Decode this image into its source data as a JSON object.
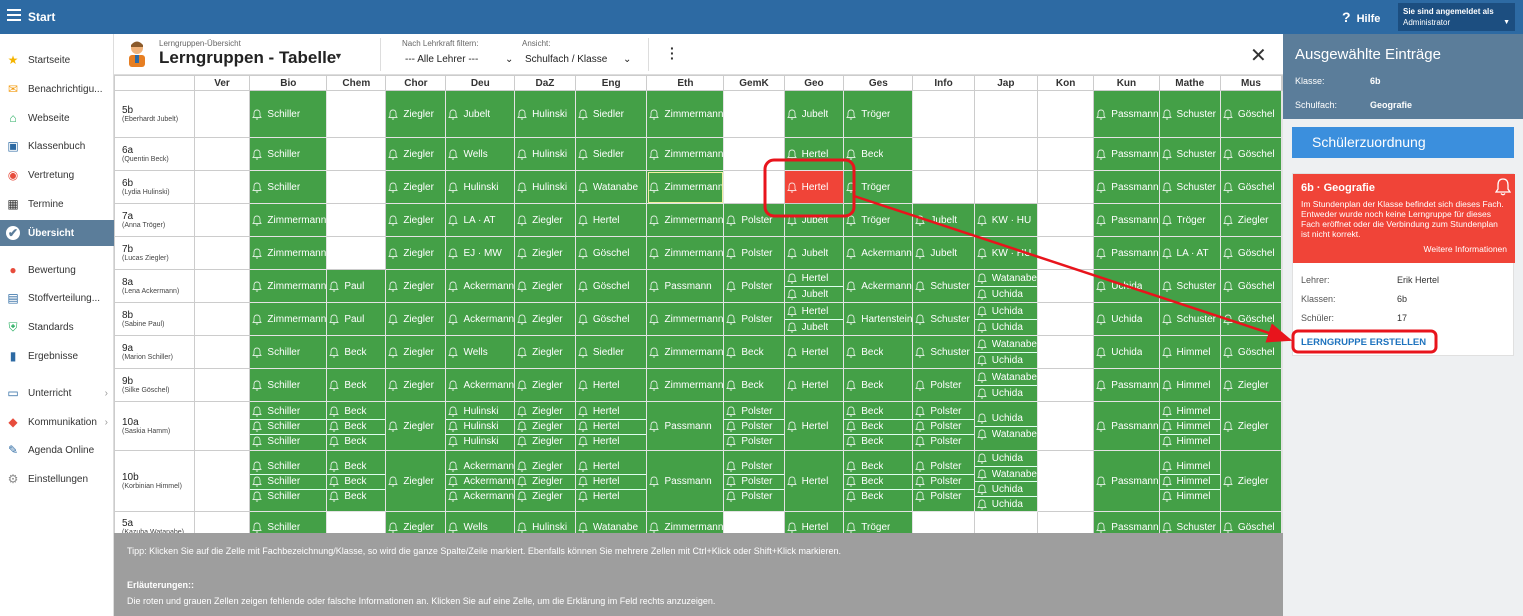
{
  "topbar": {
    "app_title": "Start",
    "help": "Hilfe",
    "login_line1": "Sie sind angemeldet als",
    "login_user": "Administrator"
  },
  "sidebar": {
    "items": [
      {
        "label": "Startseite",
        "icon": "star-icon",
        "color": "#f5b400"
      },
      {
        "label": "Benachrichtigu...",
        "icon": "mail-icon",
        "color": "#f39c12"
      },
      {
        "label": "Webseite",
        "icon": "home-icon",
        "color": "#27ae60"
      },
      {
        "label": "Klassenbuch",
        "icon": "book-icon",
        "color": "#2d6aa3"
      },
      {
        "label": "Vertretung",
        "icon": "user-swap-icon",
        "color": "#e74c3c"
      },
      {
        "label": "Termine",
        "icon": "calendar-icon",
        "color": "#333333"
      },
      {
        "label": "Übersicht",
        "icon": "check-circle-icon",
        "color": "#ffffff",
        "active": true
      },
      {
        "label": "Bewertung",
        "icon": "grade-icon",
        "color": "#e74c3c"
      },
      {
        "label": "Stoffverteilung...",
        "icon": "layers-icon",
        "color": "#2d6aa3"
      },
      {
        "label": "Standards",
        "icon": "shield-icon",
        "color": "#27ae60"
      },
      {
        "label": "Ergebnisse",
        "icon": "bar-chart-icon",
        "color": "#2d6aa3"
      },
      {
        "label": "Unterricht",
        "icon": "screen-icon",
        "color": "#2d6aa3",
        "arrow": true
      },
      {
        "label": "Kommunikation",
        "icon": "chat-icon",
        "color": "#e74c3c",
        "arrow": true
      },
      {
        "label": "Agenda Online",
        "icon": "pen-icon",
        "color": "#2d6aa3"
      },
      {
        "label": "Einstellungen",
        "icon": "gear-icon",
        "color": "#888888"
      }
    ]
  },
  "page": {
    "subtitle": "Lerngruppen-Übersicht",
    "title": "Lerngruppen - Tabelle",
    "filter_label": "Nach Lehrkraft filtern:",
    "filter_value": "--- Alle Lehrer ---",
    "view_label": "Ansicht:",
    "view_value": "Schulfach / Klasse"
  },
  "table": {
    "columns": [
      "Ver",
      "Bio",
      "Chem",
      "Chor",
      "Deu",
      "DaZ",
      "Eng",
      "Eth",
      "GemK",
      "Geo",
      "Ges",
      "Info",
      "Jap",
      "Kon",
      "Kun",
      "Mathe",
      "Mus"
    ],
    "rows": [
      {
        "class": "5b",
        "teacher": "(Eberhardt Jubelt)",
        "cells": [
          null,
          [
            "Schiller"
          ],
          null,
          [
            "Ziegler"
          ],
          [
            "Jubelt"
          ],
          [
            "Hulinski"
          ],
          [
            "Siedler"
          ],
          [
            "Zimmermann"
          ],
          null,
          [
            "Jubelt"
          ],
          [
            "Tröger"
          ],
          null,
          null,
          null,
          [
            "Passmann"
          ],
          [
            "Schuster"
          ],
          [
            "Göschel"
          ]
        ]
      },
      {
        "class": "6a",
        "teacher": "(Quentin Beck)",
        "cells": [
          null,
          [
            "Schiller"
          ],
          null,
          [
            "Ziegler"
          ],
          [
            "Wells"
          ],
          [
            "Hulinski"
          ],
          [
            "Siedler"
          ],
          [
            "Zimmermann"
          ],
          null,
          [
            "Hertel"
          ],
          [
            "Beck"
          ],
          null,
          null,
          null,
          [
            "Passmann"
          ],
          [
            "Schuster"
          ],
          [
            "Göschel"
          ]
        ]
      },
      {
        "class": "6b",
        "teacher": "(Lydia Hulinski)",
        "cells": [
          null,
          [
            "Schiller"
          ],
          null,
          [
            "Ziegler"
          ],
          [
            "Hulinski"
          ],
          [
            "Hulinski"
          ],
          [
            "Watanabe"
          ],
          [
            "Zimmermann"
          ],
          null,
          [
            "Hertel"
          ],
          [
            "Tröger"
          ],
          null,
          null,
          null,
          [
            "Passmann"
          ],
          [
            "Schuster"
          ],
          [
            "Göschel"
          ]
        ]
      },
      {
        "class": "7a",
        "teacher": "(Anna Tröger)",
        "cells": [
          null,
          [
            "Zimmermann"
          ],
          null,
          [
            "Ziegler"
          ],
          [
            "LA · AT"
          ],
          [
            "Ziegler"
          ],
          [
            "Hertel"
          ],
          [
            "Zimmermann"
          ],
          [
            "Polster"
          ],
          [
            "Jubelt"
          ],
          [
            "Tröger"
          ],
          [
            "Jubelt"
          ],
          [
            "KW · HU"
          ],
          null,
          [
            "Passmann"
          ],
          [
            "Tröger"
          ],
          [
            "Ziegler"
          ]
        ]
      },
      {
        "class": "7b",
        "teacher": "(Lucas Ziegler)",
        "cells": [
          null,
          [
            "Zimmermann"
          ],
          null,
          [
            "Ziegler"
          ],
          [
            "EJ · MW"
          ],
          [
            "Ziegler"
          ],
          [
            "Göschel"
          ],
          [
            "Zimmermann"
          ],
          [
            "Polster"
          ],
          [
            "Jubelt"
          ],
          [
            "Ackermann"
          ],
          [
            "Jubelt"
          ],
          [
            "KW · HU"
          ],
          null,
          [
            "Passmann"
          ],
          [
            "LA · AT"
          ],
          [
            "Göschel"
          ]
        ]
      },
      {
        "class": "8a",
        "teacher": "(Lena Ackermann)",
        "cells": [
          null,
          [
            "Zimmermann"
          ],
          [
            "Paul"
          ],
          [
            "Ziegler"
          ],
          [
            "Ackermann"
          ],
          [
            "Ziegler"
          ],
          [
            "Göschel"
          ],
          [
            "Passmann"
          ],
          [
            "Polster"
          ],
          [
            "Hertel",
            "Jubelt"
          ],
          [
            "Ackermann"
          ],
          [
            "Schuster"
          ],
          [
            "Watanabe",
            "Uchida"
          ],
          null,
          [
            "Uchida"
          ],
          [
            "Schuster"
          ],
          [
            "Göschel"
          ]
        ]
      },
      {
        "class": "8b",
        "teacher": "(Sabine Paul)",
        "cells": [
          null,
          [
            "Zimmermann"
          ],
          [
            "Paul"
          ],
          [
            "Ziegler"
          ],
          [
            "Ackermann"
          ],
          [
            "Ziegler"
          ],
          [
            "Göschel"
          ],
          [
            "Zimmermann"
          ],
          [
            "Polster"
          ],
          [
            "Hertel",
            "Jubelt"
          ],
          [
            "Hartenstein"
          ],
          [
            "Schuster"
          ],
          [
            "Uchida",
            "Uchida"
          ],
          null,
          [
            "Uchida"
          ],
          [
            "Schuster"
          ],
          [
            "Göschel"
          ]
        ]
      },
      {
        "class": "9a",
        "teacher": "(Marion Schiller)",
        "cells": [
          null,
          [
            "Schiller"
          ],
          [
            "Beck"
          ],
          [
            "Ziegler"
          ],
          [
            "Wells"
          ],
          [
            "Ziegler"
          ],
          [
            "Siedler"
          ],
          [
            "Zimmermann"
          ],
          [
            "Beck"
          ],
          [
            "Hertel"
          ],
          [
            "Beck"
          ],
          [
            "Schuster"
          ],
          [
            "Watanabe",
            "Uchida"
          ],
          null,
          [
            "Uchida"
          ],
          [
            "Himmel"
          ],
          [
            "Göschel"
          ]
        ]
      },
      {
        "class": "9b",
        "teacher": "(Silke Göschel)",
        "cells": [
          null,
          [
            "Schiller"
          ],
          [
            "Beck"
          ],
          [
            "Ziegler"
          ],
          [
            "Ackermann"
          ],
          [
            "Ziegler"
          ],
          [
            "Hertel"
          ],
          [
            "Zimmermann"
          ],
          [
            "Beck"
          ],
          [
            "Hertel"
          ],
          [
            "Beck"
          ],
          [
            "Polster"
          ],
          [
            "Watanabe",
            "Uchida"
          ],
          null,
          [
            "Passmann"
          ],
          [
            "Himmel"
          ],
          [
            "Ziegler"
          ]
        ]
      },
      {
        "class": "10a",
        "teacher": "(Saskia Hamm)",
        "cells": [
          null,
          [
            "Schiller",
            "Schiller",
            "Schiller"
          ],
          [
            "Beck",
            "Beck",
            "Beck"
          ],
          [
            "Ziegler"
          ],
          [
            "Hulinski",
            "Hulinski",
            "Hulinski"
          ],
          [
            "Ziegler",
            "Ziegler",
            "Ziegler"
          ],
          [
            "Hertel",
            "Hertel",
            "Hertel"
          ],
          [
            "Passmann"
          ],
          [
            "Polster",
            "Polster",
            "Polster"
          ],
          [
            "Hertel"
          ],
          [
            "Beck",
            "Beck",
            "Beck"
          ],
          [
            "Polster",
            "Polster",
            "Polster"
          ],
          [
            "Uchida",
            "Watanabe"
          ],
          null,
          [
            "Passmann"
          ],
          [
            "Himmel",
            "Himmel",
            "Himmel"
          ],
          [
            "Ziegler"
          ]
        ]
      },
      {
        "class": "10b",
        "teacher": "(Korbinian Himmel)",
        "cells": [
          null,
          [
            "Schiller",
            "Schiller",
            "Schiller"
          ],
          [
            "Beck",
            "Beck",
            "Beck"
          ],
          [
            "Ziegler"
          ],
          [
            "Ackermann",
            "Ackermann",
            "Ackermann"
          ],
          [
            "Ziegler",
            "Ziegler",
            "Ziegler"
          ],
          [
            "Hertel",
            "Hertel",
            "Hertel"
          ],
          [
            "Passmann"
          ],
          [
            "Polster",
            "Polster",
            "Polster"
          ],
          [
            "Hertel"
          ],
          [
            "Beck",
            "Beck",
            "Beck"
          ],
          [
            "Polster",
            "Polster",
            "Polster"
          ],
          [
            "Uchida",
            "Watanabe",
            "Uchida",
            "Uchida"
          ],
          null,
          [
            "Passmann"
          ],
          [
            "Himmel",
            "Himmel",
            "Himmel"
          ],
          [
            "Ziegler"
          ]
        ]
      },
      {
        "class": "5a",
        "teacher": "(Kazuha Watanabe)",
        "cells": [
          null,
          [
            "Schiller"
          ],
          null,
          [
            "Ziegler"
          ],
          [
            "Wells"
          ],
          [
            "Hulinski"
          ],
          [
            "Watanabe"
          ],
          [
            "Zimmermann"
          ],
          null,
          [
            "Hertel"
          ],
          [
            "Tröger"
          ],
          null,
          null,
          null,
          [
            "Passmann"
          ],
          [
            "Schuster"
          ],
          [
            "Göschel"
          ]
        ]
      }
    ],
    "error_cell": {
      "row": "6b",
      "column": "Geo"
    },
    "selected_cell": {
      "row": "6b",
      "column": "Eth"
    }
  },
  "tip": {
    "text": "Tipp: Klicken Sie auf die Zelle mit Fachbezeichnung/Klasse, so wird die ganze Spalte/Zeile markiert. Ebenfalls können Sie mehrere Zellen mit Ctrl+Klick oder Shift+Klick markieren.",
    "legend_title": "Erläuterungen::",
    "legend_text": "Die roten und grauen Zellen zeigen fehlende oder falsche Informationen an. Klicken Sie auf eine Zelle, um die Erklärung im Feld rechts anzuzeigen."
  },
  "panel": {
    "title": "Ausgewählte Einträge",
    "class_label": "Klasse:",
    "class_value": "6b",
    "subject_label": "Schulfach:",
    "subject_value": "Geografie",
    "assign_button": "Schülerzuordnung",
    "error": {
      "title": "6b · Geografie",
      "text": "Im Stundenplan der Klasse befindet sich dieses Fach. Entweder wurde noch keine Lerngruppe für dieses Fach eröffnet oder die Verbindung zum Stundenplan ist nicht korrekt.",
      "more": "Weitere Informationen",
      "teacher_label": "Lehrer:",
      "teacher_value": "Erik Hertel",
      "classes_label": "Klassen:",
      "classes_value": "6b",
      "students_label": "Schüler:",
      "students_value": "17",
      "action": "LERNGRUPPE ERSTELLEN"
    }
  },
  "colors": {
    "topbar": "#2d6aa3",
    "cell_ok": "#44a047",
    "cell_error": "#f04438",
    "panel_head": "#5b7d9a",
    "button": "#3b8fdd",
    "annotation": "#e8141c"
  }
}
